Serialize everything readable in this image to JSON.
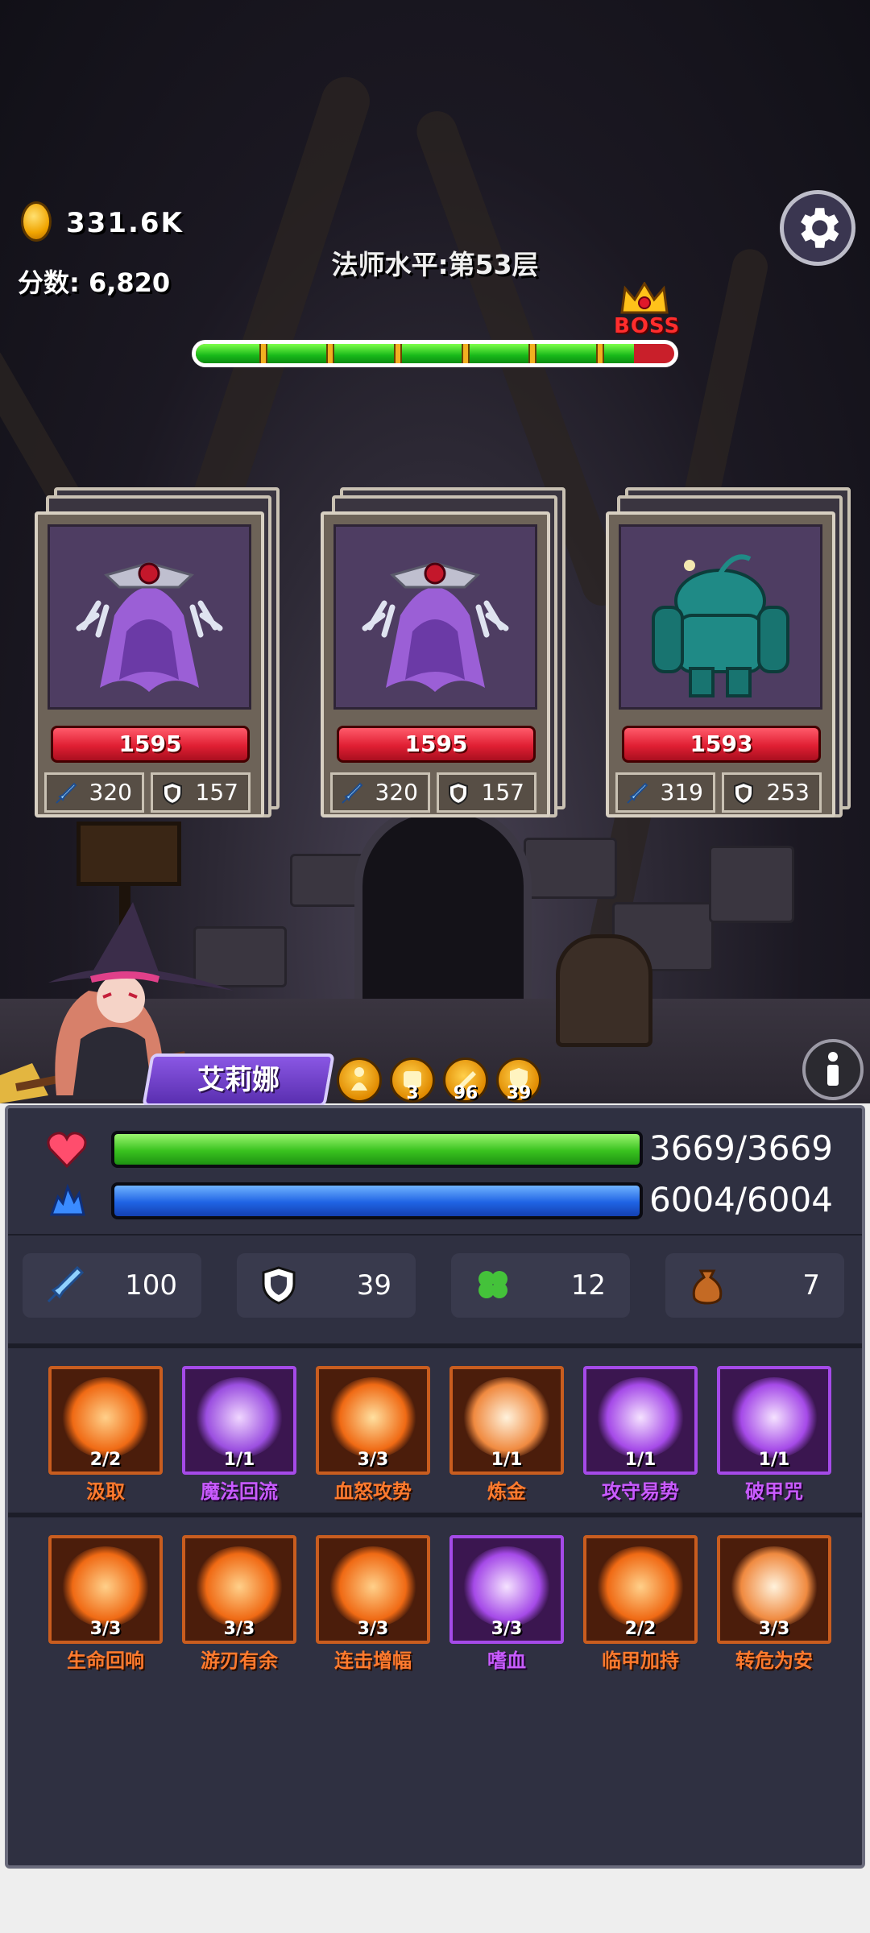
{
  "hud": {
    "coins": "331.6K",
    "score_label": "分数:",
    "score_value": "6,820",
    "level_text": "法师水平:第53层",
    "boss_label": "BOSS",
    "stage_progress": 0.915,
    "stage_markers": 6
  },
  "colors": {
    "hp_red": "#e01f33",
    "bar_green": "#39c21f",
    "bar_blue": "#1f63e4",
    "skill_orange": "#ff7a2e",
    "skill_purple": "#c95bff",
    "hero_name_bg": "#6a3bc8"
  },
  "monsters": [
    {
      "name_icon": "ghost-sorcerer-icon",
      "hp": "1595",
      "attack": "320",
      "defense": "157"
    },
    {
      "name_icon": "ghost-sorcerer-icon",
      "hp": "1595",
      "attack": "320",
      "defense": "157"
    },
    {
      "name_icon": "green-golem-icon",
      "hp": "1593",
      "attack": "319",
      "defense": "253"
    }
  ],
  "hero": {
    "name": "艾莉娜",
    "buffs": [
      {
        "icon": "person-buff-icon",
        "count": ""
      },
      {
        "icon": "fist-buff-icon",
        "count": "3"
      },
      {
        "icon": "sword-buff-icon",
        "count": "96"
      },
      {
        "icon": "shield-buff-icon",
        "count": "39"
      }
    ]
  },
  "stats": {
    "hp_text": "3669/3669",
    "hp_ratio": 1.0,
    "mp_text": "6004/6004",
    "mp_ratio": 1.0,
    "attack": "100",
    "defense": "39",
    "luck": "12",
    "bag": "7"
  },
  "skills_row1": [
    {
      "level": "2/2",
      "name": "汲取",
      "color": "orange"
    },
    {
      "level": "1/1",
      "name": "魔法回流",
      "color": "purple"
    },
    {
      "level": "3/3",
      "name": "血怒攻势",
      "color": "orange"
    },
    {
      "level": "1/1",
      "name": "炼金",
      "color": "orange"
    },
    {
      "level": "1/1",
      "name": "攻守易势",
      "color": "purple"
    },
    {
      "level": "1/1",
      "name": "破甲咒",
      "color": "purple"
    }
  ],
  "skills_row2": [
    {
      "level": "3/3",
      "name": "生命回响",
      "color": "orange"
    },
    {
      "level": "3/3",
      "name": "游刃有余",
      "color": "orange"
    },
    {
      "level": "3/3",
      "name": "连击增幅",
      "color": "orange"
    },
    {
      "level": "3/3",
      "name": "嗜血",
      "color": "purple"
    },
    {
      "level": "2/2",
      "name": "临甲加持",
      "color": "orange"
    },
    {
      "level": "3/3",
      "name": "转危为安",
      "color": "orange"
    }
  ]
}
